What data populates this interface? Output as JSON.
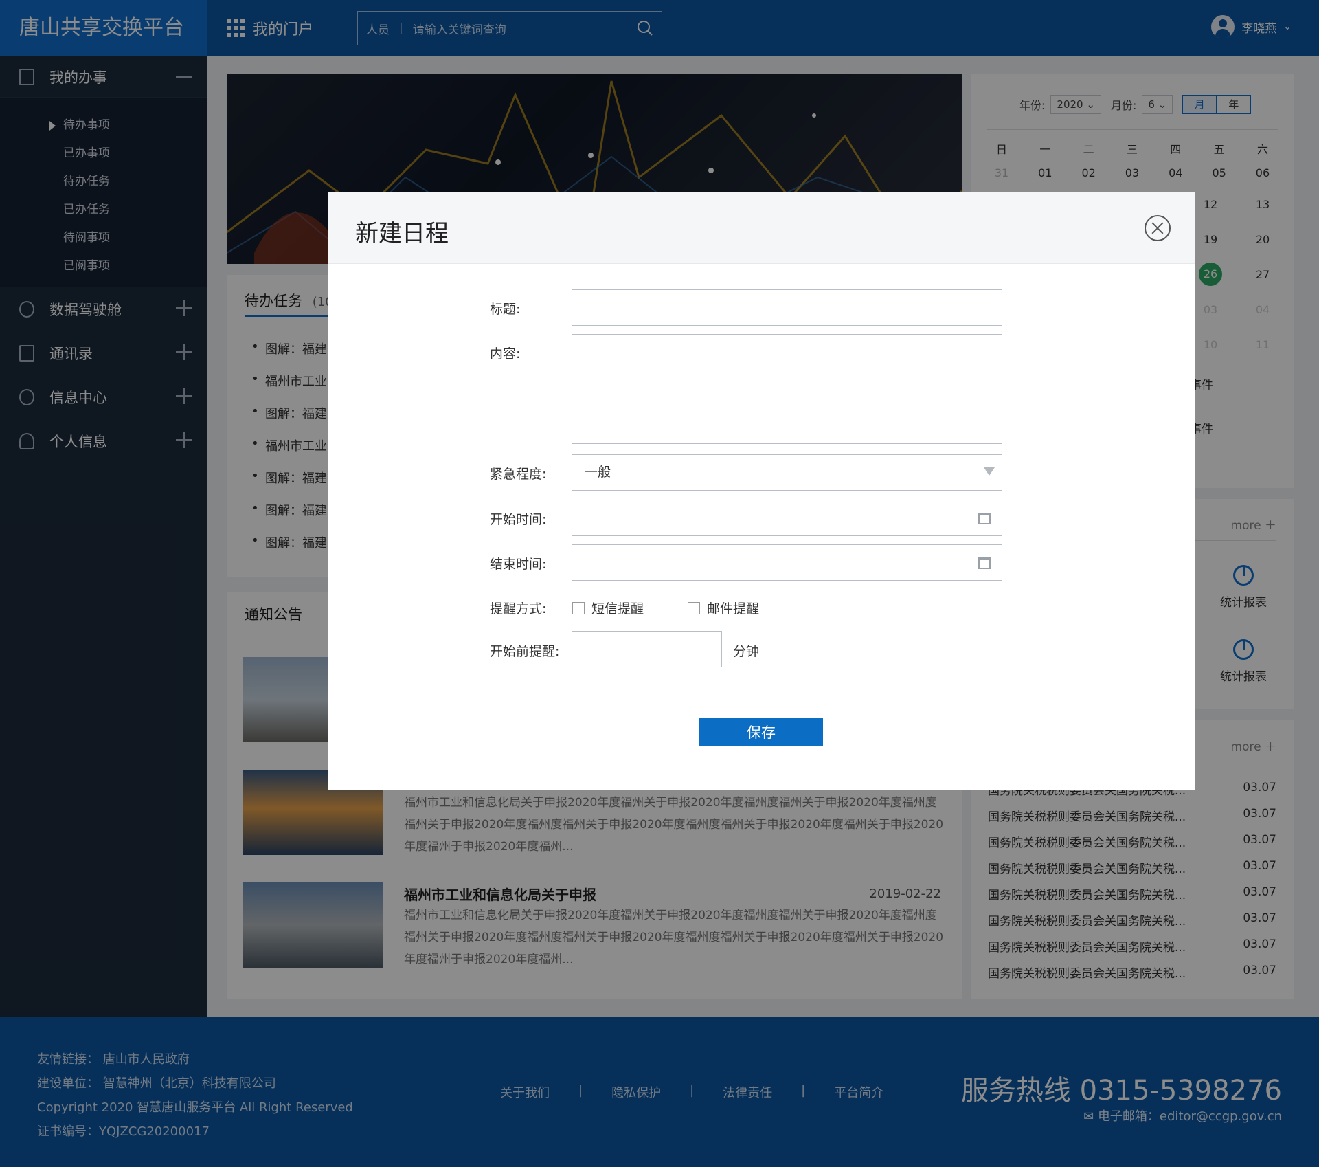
{
  "header": {
    "brand": "唐山共享交换平台",
    "portal": "我的门户",
    "search_scope": "人员",
    "search_placeholder": "请输入关键词查询",
    "user": "李晓燕"
  },
  "sidebar": {
    "section1": "我的办事",
    "sub": [
      "待办事项",
      "已办事项",
      "待办任务",
      "已办任务",
      "待阅事项",
      "已阅事项"
    ],
    "items": [
      "数据驾驶舱",
      "通讯录",
      "信息中心",
      "个人信息"
    ]
  },
  "tasks": {
    "title": "待办任务",
    "count": "(10",
    "items": [
      "图解：福建",
      "福州市工业",
      "图解：福建",
      "福州市工业",
      "图解：福建",
      "图解：福建",
      "图解：福建"
    ]
  },
  "calendar": {
    "year_label": "年份:",
    "year": "2020",
    "month_label": "月份:",
    "month": "6",
    "tab_month": "月",
    "tab_year": "年",
    "weekdays": [
      "日",
      "一",
      "二",
      "三",
      "四",
      "五",
      "六"
    ],
    "row1": [
      "31",
      "01",
      "02",
      "03",
      "04",
      "05",
      "06"
    ],
    "right_cols": [
      [
        "12",
        "13"
      ],
      [
        "19",
        "20"
      ],
      [
        "26",
        "27"
      ],
      [
        "03",
        "04"
      ],
      [
        "10",
        "11"
      ]
    ],
    "event1": "事件",
    "event2": "事件"
  },
  "stats": {
    "more": "more",
    "item1": "统计报表",
    "item2": "统计报表"
  },
  "news": {
    "more": "more",
    "items": [
      {
        "title": "国务院关税税则委员会关国务院关税...",
        "date": "03.07"
      },
      {
        "title": "国务院关税税则委员会关国务院关税...",
        "date": "03.07"
      },
      {
        "title": "国务院关税税则委员会关国务院关税...",
        "date": "03.07"
      },
      {
        "title": "国务院关税税则委员会关国务院关税...",
        "date": "03.07"
      },
      {
        "title": "国务院关税税则委员会关国务院关税...",
        "date": "03.07"
      },
      {
        "title": "国务院关税税则委员会关国务院关税...",
        "date": "03.07"
      },
      {
        "title": "国务院关税税则委员会关国务院关税...",
        "date": "03.07"
      },
      {
        "title": "国务院关税税则委员会关国务院关税...",
        "date": "03.07"
      }
    ]
  },
  "notice": {
    "title": "通知公告",
    "desc": "福州市工业和信息化局关于申报2020年度福州关于申报2020年度福州度福州关于申报2020年度福州度福州关于申报2020年度福州度福州关于申报2020年度福州度福州关于申报2020年度福州关于申报2020年度福州于申报2020年度福州...",
    "item3_title": "福州市工业和信息化局关于申报",
    "item3_date": "2019-02-22"
  },
  "footer": {
    "friend": "友情链接：  唐山市人民政府",
    "builder": "建设单位：  智慧神州（北京）科技有限公司",
    "copyright": "Copyright 2020 智慧唐山服务平台 All Right Reserved",
    "cert": "证书编号：YQJZCG20200017",
    "links": [
      "关于我们",
      "隐私保护",
      "法律责任",
      "平台简介"
    ],
    "sep": "|",
    "hotline": "服务热线  0315-5398276",
    "email": "电子邮箱：editor@ccgp.gov.cn"
  },
  "modal": {
    "title": "新建日程",
    "label_title": "标题:",
    "label_content": "内容:",
    "label_urgency": "紧急程度:",
    "urgency_value": "一般",
    "label_start": "开始时间:",
    "label_end": "结束时间:",
    "label_remind": "提醒方式:",
    "sms": "短信提醒",
    "email": "邮件提醒",
    "label_before": "开始前提醒:",
    "unit": "分钟",
    "save": "保存"
  }
}
